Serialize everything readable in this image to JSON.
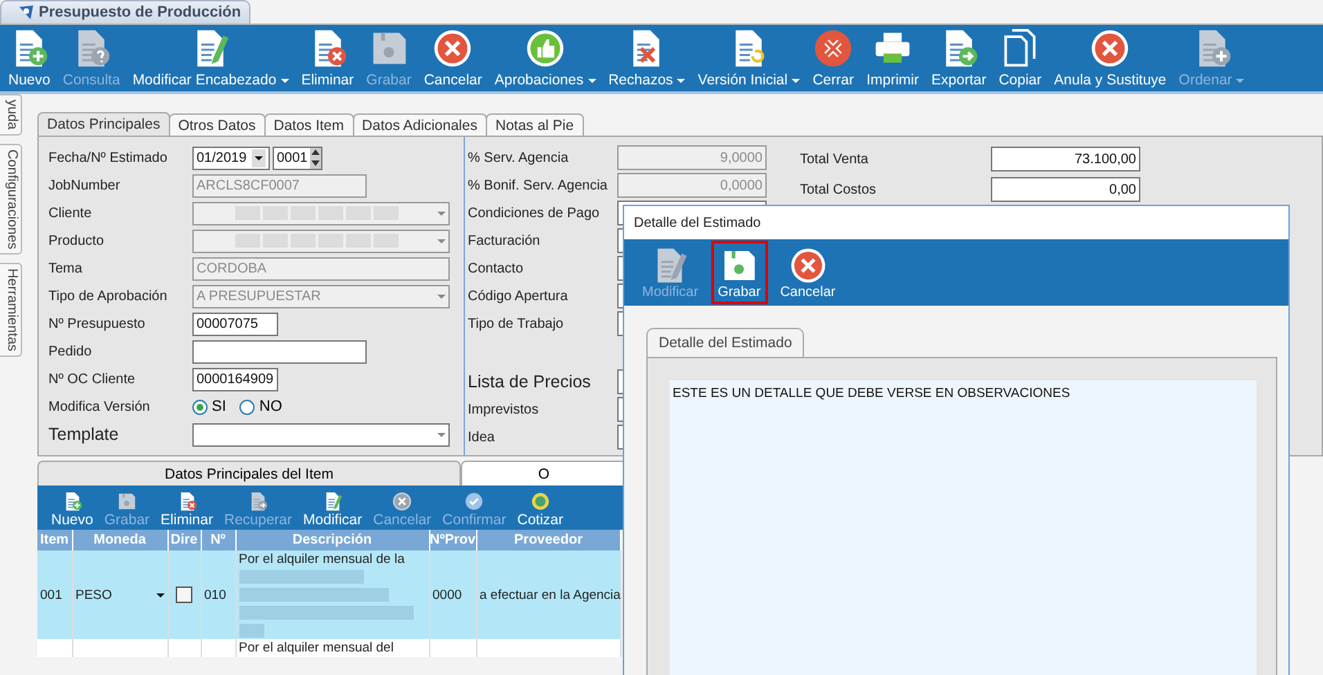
{
  "app_tab": {
    "title": "Presupuesto de Producción"
  },
  "toolbar": [
    {
      "label": "Nuevo",
      "disabled": false,
      "dropdown": false
    },
    {
      "label": "Consulta",
      "disabled": true,
      "dropdown": false
    },
    {
      "label": "Modificar Encabezado",
      "disabled": false,
      "dropdown": true
    },
    {
      "label": "Eliminar",
      "disabled": false,
      "dropdown": false
    },
    {
      "label": "Grabar",
      "disabled": true,
      "dropdown": false
    },
    {
      "label": "Cancelar",
      "disabled": false,
      "dropdown": false
    },
    {
      "label": "Aprobaciones",
      "disabled": false,
      "dropdown": true
    },
    {
      "label": "Rechazos",
      "disabled": false,
      "dropdown": true
    },
    {
      "label": "Versión Inicial",
      "disabled": false,
      "dropdown": true
    },
    {
      "label": "Cerrar",
      "disabled": false,
      "dropdown": false
    },
    {
      "label": "Imprimir",
      "disabled": false,
      "dropdown": false
    },
    {
      "label": "Exportar",
      "disabled": false,
      "dropdown": false
    },
    {
      "label": "Copiar",
      "disabled": false,
      "dropdown": false
    },
    {
      "label": "Anula y Sustituye",
      "disabled": false,
      "dropdown": false
    },
    {
      "label": "Ordenar",
      "disabled": true,
      "dropdown": true
    }
  ],
  "side_tabs": [
    "yuda",
    "Configuraciones",
    "Herramientas"
  ],
  "form_tabs": [
    {
      "label": "Datos Principales",
      "selected": true
    },
    {
      "label": "Otros Datos",
      "selected": false
    },
    {
      "label": "Datos Item",
      "selected": false
    },
    {
      "label": "Datos Adicionales",
      "selected": false
    },
    {
      "label": "Notas al Pie",
      "selected": false
    }
  ],
  "left_fields": [
    {
      "label": "Fecha/Nº Estimado",
      "kind": "date",
      "value": "01/2019",
      "number": "0001"
    },
    {
      "label": "JobNumber",
      "kind": "medium",
      "value": "ARCLS8CF0007",
      "disabled": true
    },
    {
      "label": "Cliente",
      "kind": "combo",
      "disabled": true,
      "redacted": true
    },
    {
      "label": "Producto",
      "kind": "combo",
      "disabled": true,
      "redacted": true
    },
    {
      "label": "Tema",
      "kind": "long",
      "value": "CORDOBA",
      "disabled": true
    },
    {
      "label": "Tipo de Aprobación",
      "kind": "combo",
      "value": "A PRESUPUESTAR",
      "disabled": true
    },
    {
      "label": "Nº Presupuesto",
      "kind": "short",
      "value": "00007075",
      "disabled": false
    },
    {
      "label": "Pedido",
      "kind": "medium",
      "disabled": false
    },
    {
      "label": "Nº OC Cliente",
      "kind": "short",
      "value": "0000164909",
      "disabled": false
    },
    {
      "label": "Modifica Versión",
      "kind": "radio",
      "options": [
        {
          "label": "SI",
          "selected": true
        },
        {
          "label": "NO",
          "selected": false
        }
      ]
    },
    {
      "label": "Template",
      "kind": "combo",
      "disabled": false,
      "emphasis": true
    }
  ],
  "middle_fields": {
    "upper": [
      {
        "label": "% Serv. Agencia",
        "value": "9,0000",
        "disabled": true
      },
      {
        "label": "% Bonif. Serv. Agencia",
        "value": "0,0000",
        "disabled": true
      },
      {
        "label": "Condiciones de Pago"
      },
      {
        "label": "Facturación"
      },
      {
        "label": "Contacto"
      },
      {
        "label": "Código Apertura"
      },
      {
        "label": "Tipo de Trabajo"
      }
    ],
    "lower": [
      {
        "label": "Lista de Precios",
        "emphasis": true
      },
      {
        "label": "Imprevistos"
      },
      {
        "label": "Idea"
      }
    ]
  },
  "totals": [
    {
      "label": "Total Venta",
      "value": "73.100,00"
    },
    {
      "label": "Total Costos",
      "value": "0,00"
    }
  ],
  "item_tabs": [
    {
      "label": "Datos Principales del Item",
      "selected": false
    },
    {
      "label": "O",
      "selected": true
    }
  ],
  "item_toolbar": [
    {
      "label": "Nuevo",
      "disabled": false
    },
    {
      "label": "Grabar",
      "disabled": true
    },
    {
      "label": "Eliminar",
      "disabled": false
    },
    {
      "label": "Recuperar",
      "disabled": true
    },
    {
      "label": "Modificar",
      "disabled": false
    },
    {
      "label": "Cancelar",
      "disabled": true
    },
    {
      "label": "Confirmar",
      "disabled": true
    },
    {
      "label": "Cotizar",
      "disabled": false
    }
  ],
  "grid": {
    "columns": [
      "Item",
      "Moneda",
      "Dire",
      "Nº",
      "Descripción",
      "NºProv",
      "Proveedor"
    ],
    "rows": [
      {
        "selected": true,
        "item": "001",
        "moneda": "PESO",
        "dire_checked": false,
        "numero": "010",
        "descripcion": "Por el alquiler mensual de la",
        "redacted": true,
        "nprov": "0000",
        "proveedor": "a efectuar en la Agencia"
      },
      {
        "selected": false,
        "descripcion": "Por el alquiler mensual del"
      }
    ]
  },
  "dialog": {
    "title": "Detalle del Estimado",
    "buttons": [
      {
        "label": "Modificar",
        "disabled": true,
        "highlighted": false
      },
      {
        "label": "Grabar",
        "disabled": false,
        "highlighted": true
      },
      {
        "label": "Cancelar",
        "disabled": false,
        "highlighted": false
      }
    ],
    "tab": "Detalle del Estimado",
    "text": "ESTE ES UN DETALLE QUE DEBE VERSE EN OBSERVACIONES"
  }
}
